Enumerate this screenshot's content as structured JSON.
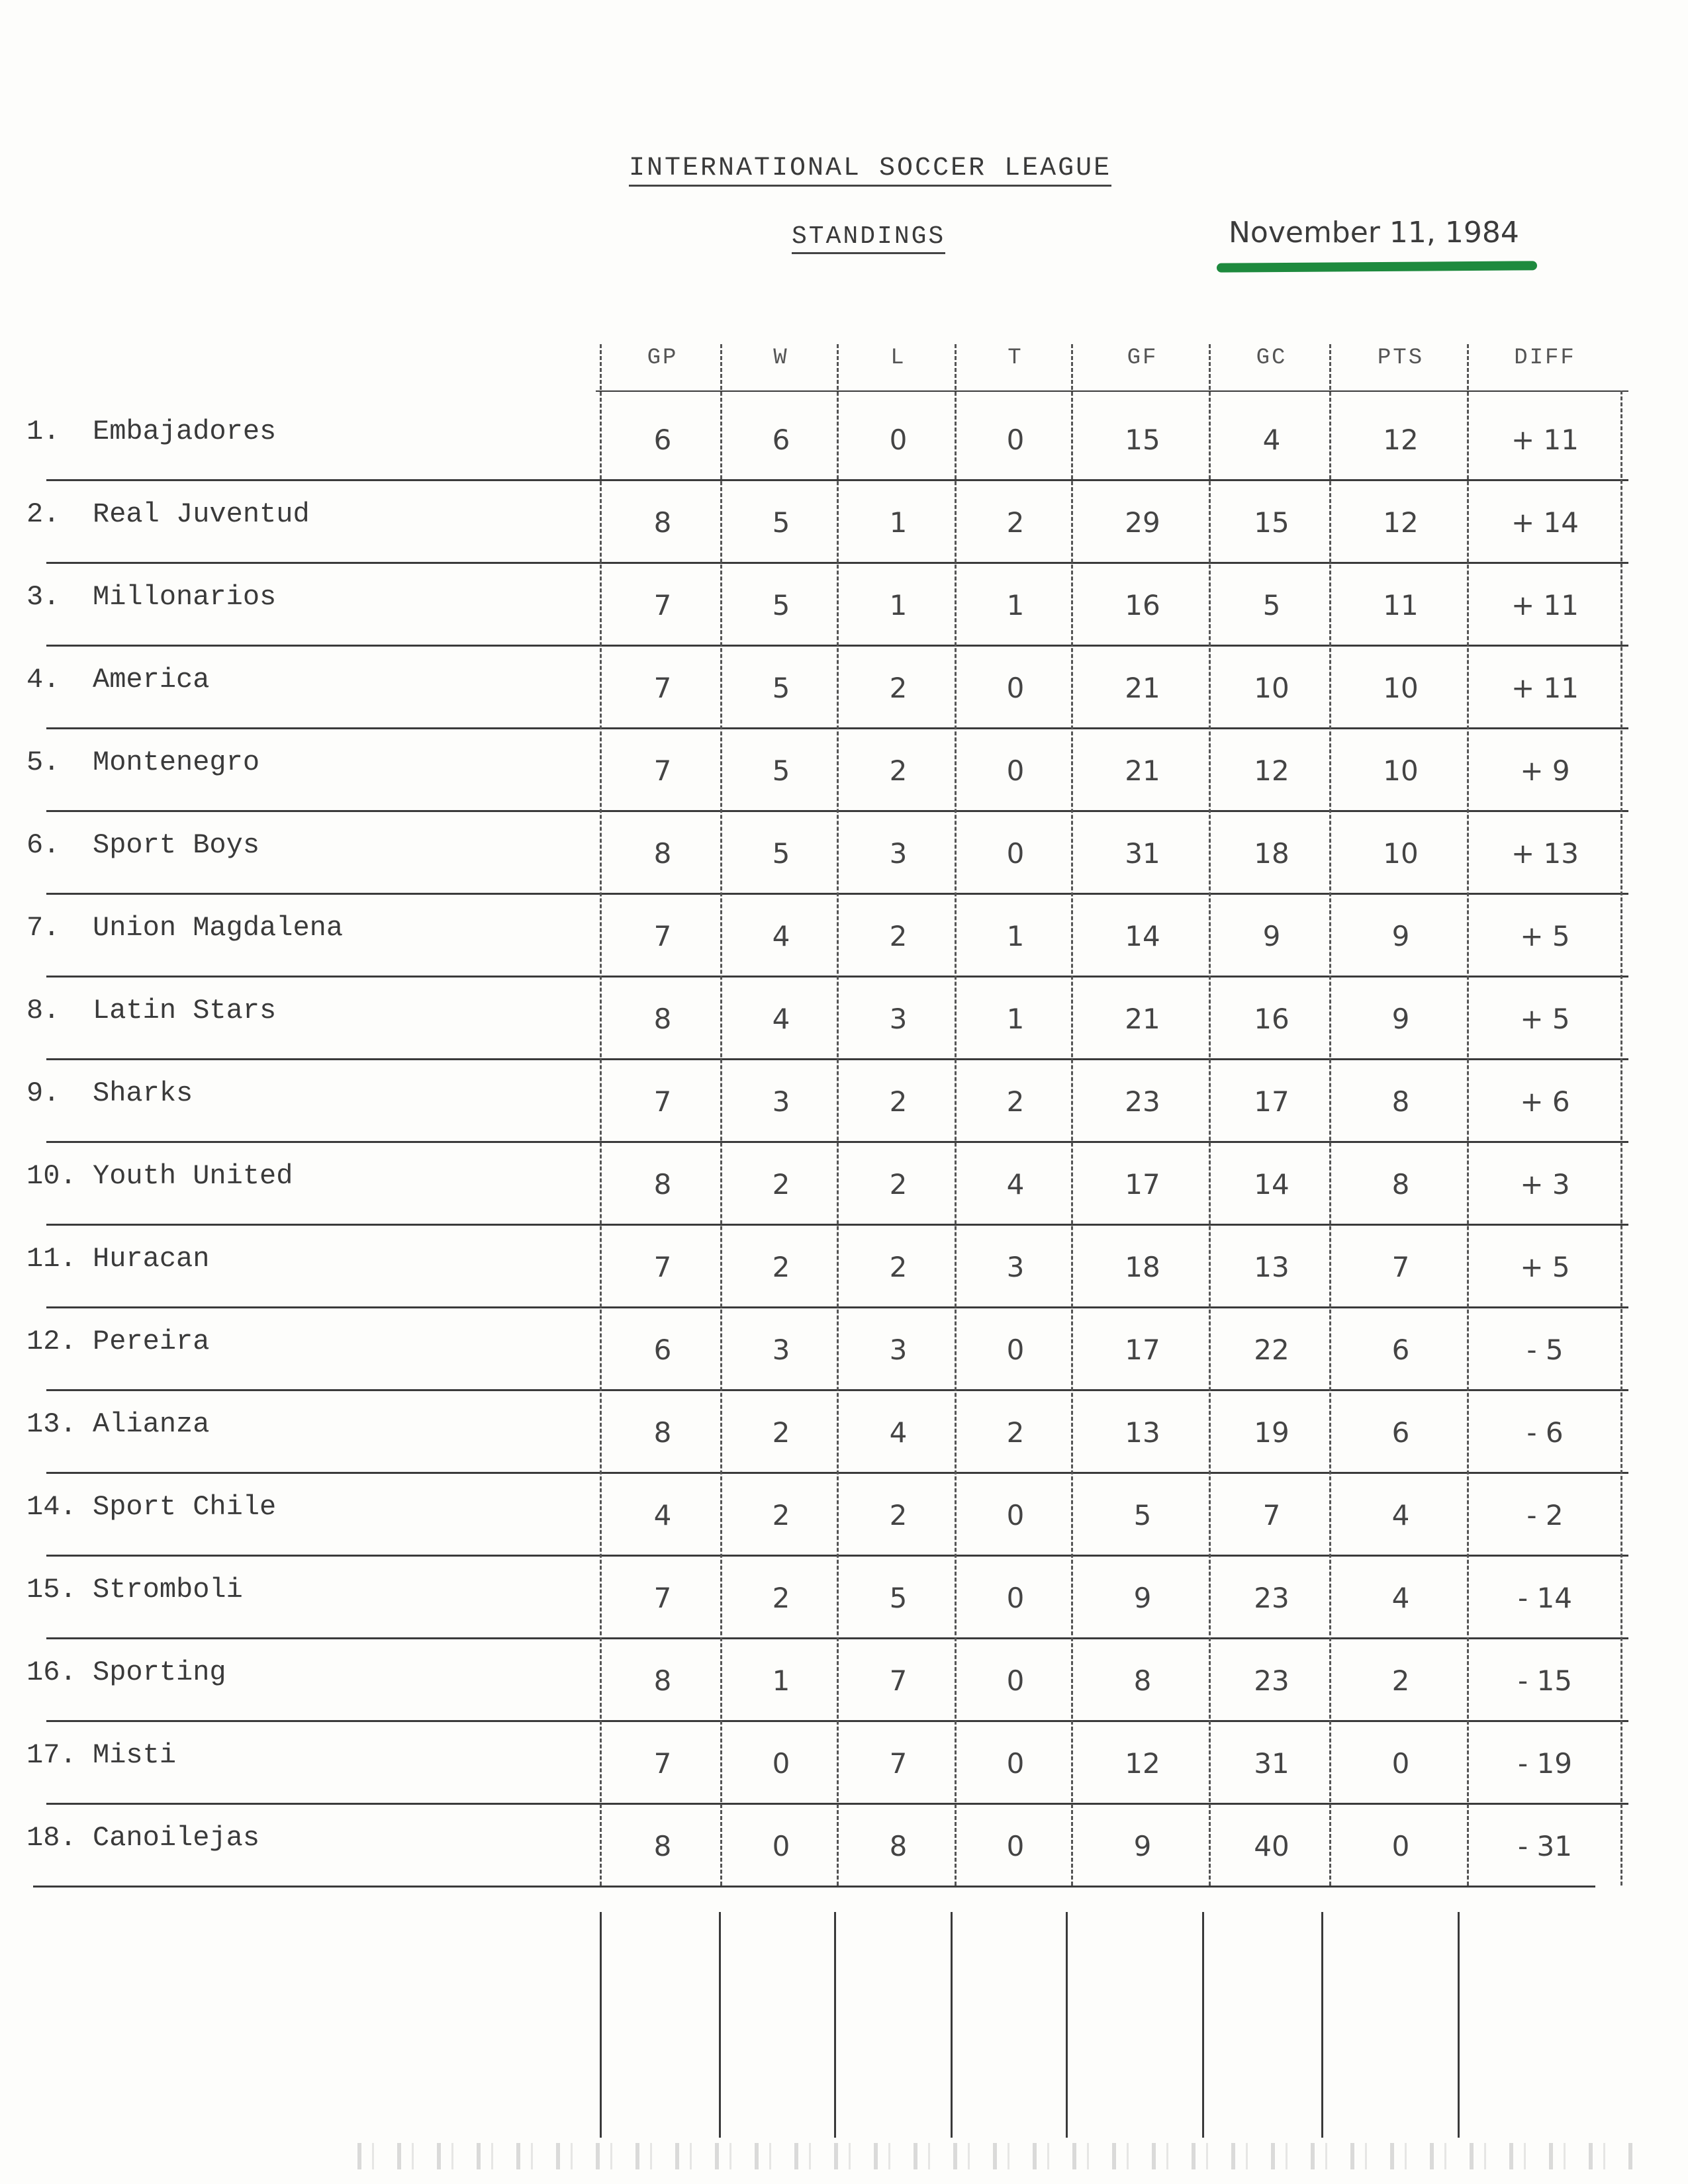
{
  "header": {
    "title": "INTERNATIONAL SOCCER LEAGUE",
    "subtitle": "STANDINGS",
    "date": "November 11, 1984"
  },
  "highlight_color": "#1e8a3e",
  "columns": [
    "GP",
    "W",
    "L",
    "T",
    "GF",
    "GC",
    "PTS",
    "DIFF"
  ],
  "rows": [
    {
      "rank": "1.",
      "team": "Embajadores",
      "gp": "6",
      "w": "6",
      "l": "0",
      "t": "0",
      "gf": "15",
      "gc": "4",
      "pts": "12",
      "diff": "+ 11"
    },
    {
      "rank": "2.",
      "team": "Real Juventud",
      "gp": "8",
      "w": "5",
      "l": "1",
      "t": "2",
      "gf": "29",
      "gc": "15",
      "pts": "12",
      "diff": "+ 14"
    },
    {
      "rank": "3.",
      "team": "Millonarios",
      "gp": "7",
      "w": "5",
      "l": "1",
      "t": "1",
      "gf": "16",
      "gc": "5",
      "pts": "11",
      "diff": "+ 11"
    },
    {
      "rank": "4.",
      "team": "America",
      "gp": "7",
      "w": "5",
      "l": "2",
      "t": "0",
      "gf": "21",
      "gc": "10",
      "pts": "10",
      "diff": "+ 11"
    },
    {
      "rank": "5.",
      "team": "Montenegro",
      "gp": "7",
      "w": "5",
      "l": "2",
      "t": "0",
      "gf": "21",
      "gc": "12",
      "pts": "10",
      "diff": "+ 9"
    },
    {
      "rank": "6.",
      "team": "Sport Boys",
      "gp": "8",
      "w": "5",
      "l": "3",
      "t": "0",
      "gf": "31",
      "gc": "18",
      "pts": "10",
      "diff": "+ 13"
    },
    {
      "rank": "7.",
      "team": "Union Magdalena",
      "gp": "7",
      "w": "4",
      "l": "2",
      "t": "1",
      "gf": "14",
      "gc": "9",
      "pts": "9",
      "diff": "+ 5"
    },
    {
      "rank": "8.",
      "team": "Latin Stars",
      "gp": "8",
      "w": "4",
      "l": "3",
      "t": "1",
      "gf": "21",
      "gc": "16",
      "pts": "9",
      "diff": "+ 5"
    },
    {
      "rank": "9.",
      "team": "Sharks",
      "gp": "7",
      "w": "3",
      "l": "2",
      "t": "2",
      "gf": "23",
      "gc": "17",
      "pts": "8",
      "diff": "+ 6"
    },
    {
      "rank": "10.",
      "team": "Youth United",
      "gp": "8",
      "w": "2",
      "l": "2",
      "t": "4",
      "gf": "17",
      "gc": "14",
      "pts": "8",
      "diff": "+ 3"
    },
    {
      "rank": "11.",
      "team": "Huracan",
      "gp": "7",
      "w": "2",
      "l": "2",
      "t": "3",
      "gf": "18",
      "gc": "13",
      "pts": "7",
      "diff": "+ 5"
    },
    {
      "rank": "12.",
      "team": "Pereira",
      "gp": "6",
      "w": "3",
      "l": "3",
      "t": "0",
      "gf": "17",
      "gc": "22",
      "pts": "6",
      "diff": "- 5"
    },
    {
      "rank": "13.",
      "team": "Alianza",
      "gp": "8",
      "w": "2",
      "l": "4",
      "t": "2",
      "gf": "13",
      "gc": "19",
      "pts": "6",
      "diff": "- 6"
    },
    {
      "rank": "14.",
      "team": "Sport Chile",
      "gp": "4",
      "w": "2",
      "l": "2",
      "t": "0",
      "gf": "5",
      "gc": "7",
      "pts": "4",
      "diff": "- 2"
    },
    {
      "rank": "15.",
      "team": "Stromboli",
      "gp": "7",
      "w": "2",
      "l": "5",
      "t": "0",
      "gf": "9",
      "gc": "23",
      "pts": "4",
      "diff": "- 14"
    },
    {
      "rank": "16.",
      "team": "Sporting",
      "gp": "8",
      "w": "1",
      "l": "7",
      "t": "0",
      "gf": "8",
      "gc": "23",
      "pts": "2",
      "diff": "- 15"
    },
    {
      "rank": "17.",
      "team": "Misti",
      "gp": "7",
      "w": "0",
      "l": "7",
      "t": "0",
      "gf": "12",
      "gc": "31",
      "pts": "0",
      "diff": "- 19"
    },
    {
      "rank": "18.",
      "team": "Canoilejas",
      "gp": "8",
      "w": "0",
      "l": "8",
      "t": "0",
      "gf": "9",
      "gc": "40",
      "pts": "0",
      "diff": "- 31"
    }
  ]
}
